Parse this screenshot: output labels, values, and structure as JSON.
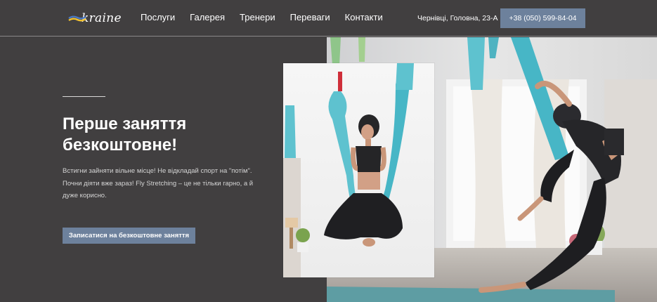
{
  "header": {
    "logo_text": "kraine",
    "nav": [
      {
        "label": "Послуги"
      },
      {
        "label": "Галерея"
      },
      {
        "label": "Тренери"
      },
      {
        "label": "Переваги"
      },
      {
        "label": "Контакти"
      }
    ],
    "address": "Чернівці, Головна, 23-А",
    "phone": "+38 (050) 599-84-04"
  },
  "hero": {
    "title": "Перше заняття безкоштовне!",
    "text": "Встигни зайняти вільне місце! Не відкладай спорт на \"потім\". Почни діяти вже зараз! Fly Stretching – це не тільки гарно, а й дуже корисно.",
    "cta": "Записатися на безкоштовне заняття"
  },
  "colors": {
    "background": "#413f40",
    "accent": "#6d819c",
    "hammock": "#5ec2cf"
  }
}
